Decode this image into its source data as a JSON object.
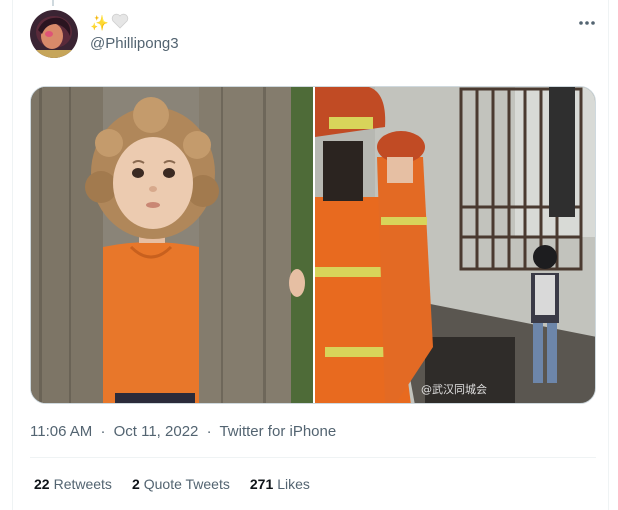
{
  "tweet": {
    "display_name_emojis": [
      "✨",
      "🤍"
    ],
    "handle": "@Phillipong3",
    "timestamp": "11:06 AM",
    "date": "Oct 11, 2022",
    "source": "Twitter for iPhone",
    "separator": "·",
    "more_icon": "more-horizontal-icon",
    "media": {
      "left_image": "child-behind-wooden-fence-photo",
      "right_image": "firefighters-child-stuck-in-window-grille-photo",
      "watermark": "@武汉同城会"
    }
  },
  "stats": [
    {
      "count": "22",
      "label": "Retweets"
    },
    {
      "count": "2",
      "label": "Quote Tweets"
    },
    {
      "count": "271",
      "label": "Likes"
    }
  ],
  "colors": {
    "text_primary": "#0f1419",
    "text_secondary": "#536471",
    "divider": "#eff3f4",
    "firefighter_orange": "#e86a1f"
  }
}
